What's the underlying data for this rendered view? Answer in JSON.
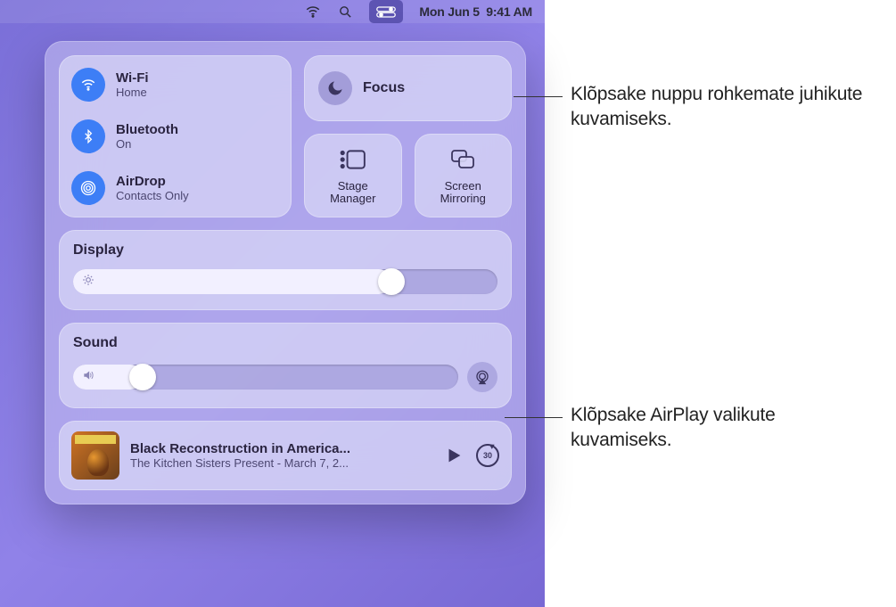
{
  "menubar": {
    "date": "Mon Jun 5",
    "time": "9:41 AM"
  },
  "connectivity": {
    "wifi": {
      "title": "Wi-Fi",
      "status": "Home"
    },
    "bluetooth": {
      "title": "Bluetooth",
      "status": "On"
    },
    "airdrop": {
      "title": "AirDrop",
      "status": "Contacts Only"
    }
  },
  "focus": {
    "label": "Focus"
  },
  "tiles": {
    "stage": {
      "line1": "Stage",
      "line2": "Manager"
    },
    "mirror": {
      "line1": "Screen",
      "line2": "Mirroring"
    }
  },
  "display": {
    "label": "Display",
    "value_percent": 75
  },
  "sound": {
    "label": "Sound",
    "value_percent": 18
  },
  "media": {
    "title": "Black Reconstruction in America...",
    "subtitle": "The Kitchen Sisters Present - March 7, 2...",
    "skip_seconds": "30"
  },
  "callouts": {
    "focus": "Klõpsake nuppu rohkemate juhikute kuvamiseks.",
    "airplay": "Klõpsake AirPlay valikute kuvamiseks."
  }
}
